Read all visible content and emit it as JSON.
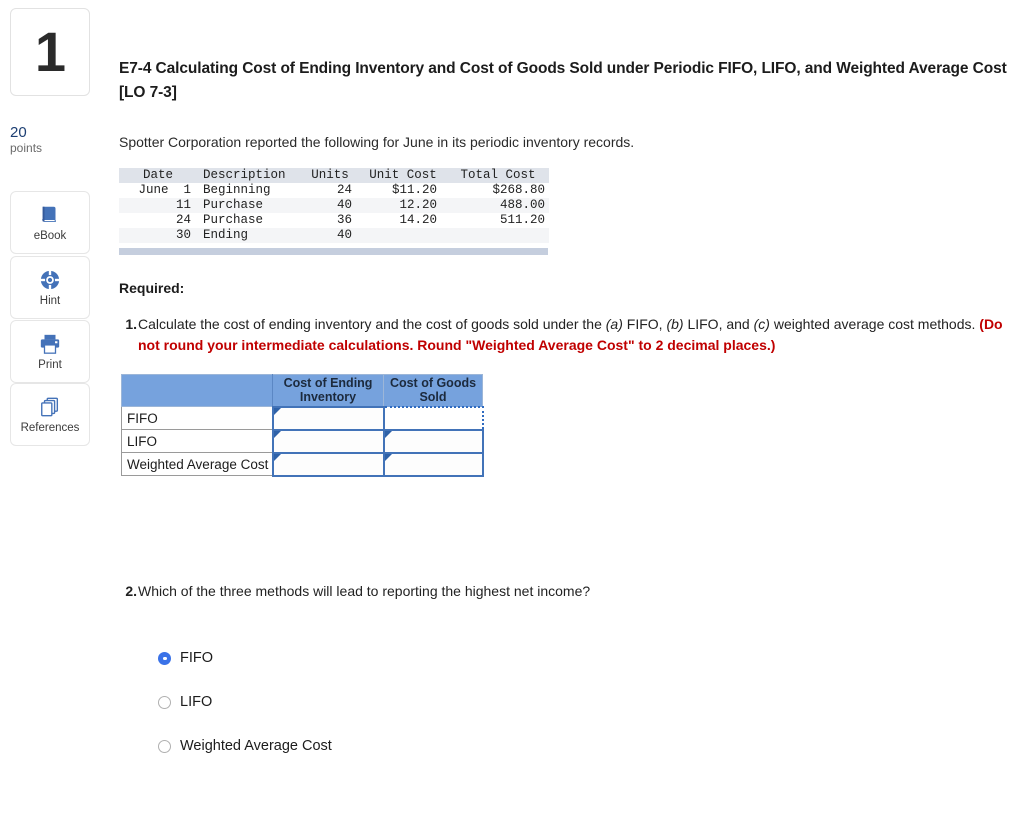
{
  "question_number": "1",
  "points": {
    "value": "20",
    "label": "points"
  },
  "tools": [
    {
      "name": "ebook",
      "label": "eBook",
      "icon": "book-icon"
    },
    {
      "name": "hint",
      "label": "Hint",
      "icon": "life-preserver-icon"
    },
    {
      "name": "print",
      "label": "Print",
      "icon": "printer-icon"
    },
    {
      "name": "references",
      "label": "References",
      "icon": "stacked-pages-icon"
    }
  ],
  "exercise": {
    "title": "E7-4 Calculating Cost of Ending Inventory and Cost of Goods Sold under Periodic FIFO, LIFO, and Weighted Average Cost [LO 7-3]",
    "intro": "Spotter Corporation reported the following for June in its periodic inventory records."
  },
  "inventory_table": {
    "headers": [
      "Date",
      "Description",
      "Units",
      "Unit Cost",
      "Total Cost"
    ],
    "rows": [
      {
        "date": "June  1",
        "description": "Beginning",
        "units": "24",
        "unit_cost": "$11.20",
        "total_cost": "$268.80"
      },
      {
        "date": "11",
        "description": "Purchase",
        "units": "40",
        "unit_cost": "12.20",
        "total_cost": "488.00"
      },
      {
        "date": "24",
        "description": "Purchase",
        "units": "36",
        "unit_cost": "14.20",
        "total_cost": "511.20"
      },
      {
        "date": "30",
        "description": "Ending",
        "units": "40",
        "unit_cost": "",
        "total_cost": ""
      }
    ]
  },
  "required_heading": "Required:",
  "question1": {
    "number": "1.",
    "text_part1": "Calculate the cost of ending inventory and the cost of goods sold under the ",
    "label_a": "(a)",
    "text_a": " FIFO, ",
    "label_b": "(b)",
    "text_b": " LIFO, and ",
    "label_c": "(c)",
    "text_c": " weighted average cost methods. ",
    "red_note": "(Do not round your intermediate calculations. Round \"Weighted Average Cost\" to 2 decimal places.)"
  },
  "answer_grid": {
    "headers": [
      "",
      "Cost of Ending Inventory",
      "Cost of Goods Sold"
    ],
    "header_ending_inventory_line1": "Cost of Ending",
    "header_ending_inventory_line2": "Inventory",
    "header_cogs_line1": "Cost of Goods",
    "header_cogs_line2": "Sold",
    "rows": [
      {
        "label": "FIFO",
        "ending_inventory": "",
        "cogs": ""
      },
      {
        "label": "LIFO",
        "ending_inventory": "",
        "cogs": ""
      },
      {
        "label": "Weighted Average Cost",
        "ending_inventory": "",
        "cogs": ""
      }
    ],
    "selected_cell": "fifo-cogs"
  },
  "question2": {
    "number": "2.",
    "text": "Which of the three methods will lead to reporting the highest net income?",
    "choices": [
      {
        "label": "FIFO",
        "checked": true
      },
      {
        "label": "LIFO",
        "checked": false
      },
      {
        "label": "Weighted Average Cost",
        "checked": false
      }
    ]
  },
  "colors": {
    "header_blue": "#76a2dd",
    "cell_border_blue": "#4273b8",
    "radio_blue": "#3a72e8",
    "red_note": "#c00000",
    "points_blue": "#1d3f73",
    "table_header_bg": "#dfe3ea",
    "table_bottom_bar": "#c5cede",
    "icon_blue": "#4472b8"
  }
}
